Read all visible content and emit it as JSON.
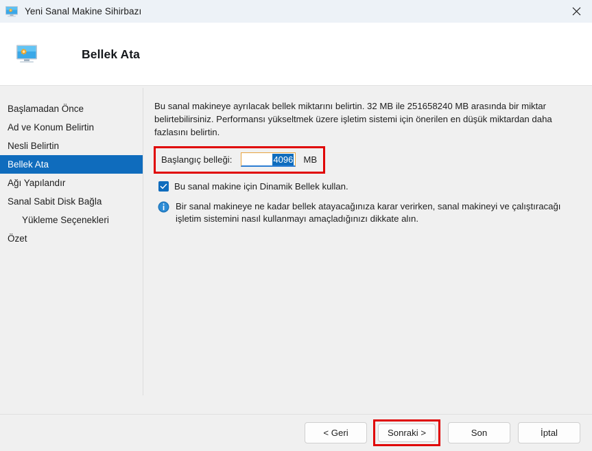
{
  "titlebar": {
    "title": "Yeni Sanal Makine Sihirbazı",
    "icon": "virtual-machine-monitor-icon",
    "close_label": "✕"
  },
  "header": {
    "title": "Bellek Ata",
    "icon": "virtual-machine-monitor-icon"
  },
  "sidebar": {
    "items": [
      {
        "label": "Başlamadan Önce",
        "selected": false,
        "indent": false
      },
      {
        "label": "Ad ve Konum Belirtin",
        "selected": false,
        "indent": false
      },
      {
        "label": "Nesli Belirtin",
        "selected": false,
        "indent": false
      },
      {
        "label": "Bellek Ata",
        "selected": true,
        "indent": false
      },
      {
        "label": "Ağı Yapılandır",
        "selected": false,
        "indent": false
      },
      {
        "label": "Sanal Sabit Disk Bağla",
        "selected": false,
        "indent": false
      },
      {
        "label": "Yükleme Seçenekleri",
        "selected": false,
        "indent": true
      },
      {
        "label": "Özet",
        "selected": false,
        "indent": false
      }
    ]
  },
  "main": {
    "description": "Bu sanal makineye ayrılacak bellek miktarını belirtin. 32 MB ile 251658240 MB arasında bir miktar belirtebilirsiniz. Performansı yükseltmek üzere işletim sistemi için önerilen en düşük miktardan daha fazlasını belirtin.",
    "memory_field": {
      "label": "Başlangıç belleği:",
      "value": "4096",
      "unit": "MB",
      "selected": true
    },
    "checkbox": {
      "label": "Bu sanal makine için Dinamik Bellek kullan.",
      "checked": true
    },
    "info": {
      "icon": "info-icon",
      "text": "Bir sanal makineye ne kadar bellek atayacağınıza karar verirken, sanal makineyi ve çalıştıracağı işletim sistemini nasıl kullanmayı amaçladığınızı dikkate alın."
    }
  },
  "footer": {
    "back_label": "< Geri",
    "next_label": "Sonraki >",
    "finish_label": "Son",
    "cancel_label": "İptal"
  },
  "colors": {
    "accent_blue": "#0f6cbd",
    "annotation_red": "#e00000",
    "titlebar_bg": "#edf2f7",
    "body_bg": "#f0f0f0",
    "input_border": "#e7a33e"
  }
}
